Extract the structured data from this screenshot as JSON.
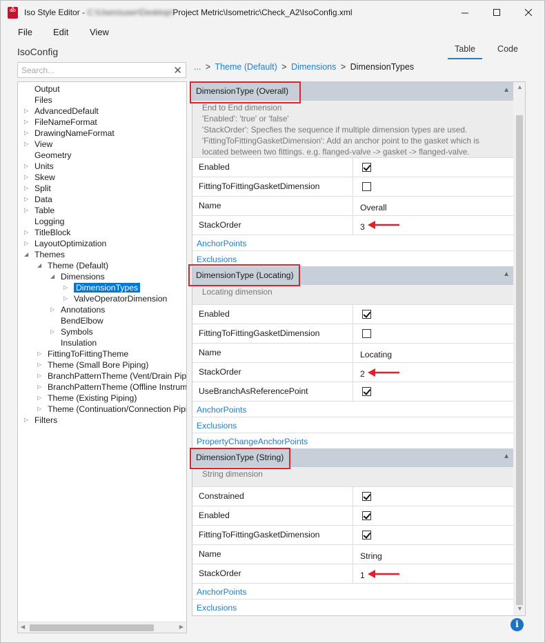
{
  "window": {
    "app_name": "Iso Style Editor",
    "title_separator": " - ",
    "title_blurred": "C:\\Users\\user\\Desktop\\",
    "title_path": "Project Metric\\Isometric\\Check_A2\\IsoConfig.xml",
    "icon_letter": "A",
    "icon_sub": "ISO"
  },
  "menu": {
    "file": "File",
    "edit": "Edit",
    "view": "View"
  },
  "header": {
    "title": "IsoConfig",
    "tab_table": "Table",
    "tab_code": "Code"
  },
  "search": {
    "placeholder": "Search...",
    "value": ""
  },
  "tree": [
    {
      "label": "Output",
      "level": 0,
      "arrow": false
    },
    {
      "label": "Files",
      "level": 0,
      "arrow": false
    },
    {
      "label": "AdvancedDefault",
      "level": 0,
      "arrow": true
    },
    {
      "label": "FileNameFormat",
      "level": 0,
      "arrow": true
    },
    {
      "label": "DrawingNameFormat",
      "level": 0,
      "arrow": true
    },
    {
      "label": "View",
      "level": 0,
      "arrow": true
    },
    {
      "label": "Geometry",
      "level": 0,
      "arrow": false
    },
    {
      "label": "Units",
      "level": 0,
      "arrow": true
    },
    {
      "label": "Skew",
      "level": 0,
      "arrow": true
    },
    {
      "label": "Split",
      "level": 0,
      "arrow": true
    },
    {
      "label": "Data",
      "level": 0,
      "arrow": true
    },
    {
      "label": "Table",
      "level": 0,
      "arrow": true
    },
    {
      "label": "Logging",
      "level": 0,
      "arrow": false
    },
    {
      "label": "TitleBlock",
      "level": 0,
      "arrow": true
    },
    {
      "label": "LayoutOptimization",
      "level": 0,
      "arrow": true
    },
    {
      "label": "Themes",
      "level": 0,
      "arrow": "open"
    },
    {
      "label": "Theme (Default)",
      "level": 1,
      "arrow": "open"
    },
    {
      "label": "Dimensions",
      "level": 2,
      "arrow": "open"
    },
    {
      "label": "DimensionTypes",
      "level": 3,
      "arrow": true,
      "selected": true
    },
    {
      "label": "ValveOperatorDimension",
      "level": 3,
      "arrow": true
    },
    {
      "label": "Annotations",
      "level": 2,
      "arrow": true
    },
    {
      "label": "BendElbow",
      "level": 2,
      "arrow": false
    },
    {
      "label": "Symbols",
      "level": 2,
      "arrow": true
    },
    {
      "label": "Insulation",
      "level": 2,
      "arrow": false
    },
    {
      "label": "FittingToFittingTheme",
      "level": 1,
      "arrow": true
    },
    {
      "label": "Theme (Small Bore Piping)",
      "level": 1,
      "arrow": true
    },
    {
      "label": "BranchPatternTheme (Vent/Drain Piping)",
      "level": 1,
      "arrow": true
    },
    {
      "label": "BranchPatternTheme (Offline Instruments)",
      "level": 1,
      "arrow": true
    },
    {
      "label": "Theme (Existing Piping)",
      "level": 1,
      "arrow": true
    },
    {
      "label": "Theme (Continuation/Connection Piping)",
      "level": 1,
      "arrow": true
    },
    {
      "label": "Filters",
      "level": 0,
      "arrow": true
    }
  ],
  "breadcrumb": {
    "ellipsis": "...",
    "sep": ">",
    "item1": "Theme (Default)",
    "item2": "Dimensions",
    "current": "DimensionTypes"
  },
  "sections": {
    "overall": {
      "title": "DimensionType (Overall)",
      "desc": [
        "End to End dimension",
        "'Enabled': 'true' or 'false'",
        "'StackOrder': Specfies the sequence if multiple dimension types are used.",
        "'FittingToFittingGasketDimension': Add an anchor point to the gasket which is",
        "located between two fittings. e.g. flanged-valve -> gasket -> flanged-valve."
      ],
      "enabled_label": "Enabled",
      "gasket_label": "FittingToFittingGasketDimension",
      "name_label": "Name",
      "name_value": "Overall",
      "stack_label": "StackOrder",
      "stack_value": "3",
      "anchor_link": "AnchorPoints",
      "exclusions_link": "Exclusions"
    },
    "locating": {
      "title": "DimensionType (Locating)",
      "desc": "Locating dimension",
      "enabled_label": "Enabled",
      "gasket_label": "FittingToFittingGasketDimension",
      "name_label": "Name",
      "name_value": "Locating",
      "stack_label": "StackOrder",
      "stack_value": "2",
      "branch_label": "UseBranchAsReferencePoint",
      "anchor_link": "AnchorPoints",
      "exclusions_link": "Exclusions",
      "prop_change_link": "PropertyChangeAnchorPoints"
    },
    "string": {
      "title": "DimensionType (String)",
      "desc": "String dimension",
      "constrained_label": "Constrained",
      "enabled_label": "Enabled",
      "gasket_label": "FittingToFittingGasketDimension",
      "name_label": "Name",
      "name_value": "String",
      "stack_label": "StackOrder",
      "stack_value": "1",
      "anchor_link": "AnchorPoints",
      "exclusions_link": "Exclusions"
    }
  },
  "checks": {
    "overall_enabled": true,
    "overall_gasket": false,
    "locating_enabled": true,
    "locating_gasket": false,
    "locating_branch": true,
    "string_constrained": true,
    "string_enabled": true,
    "string_gasket": true
  },
  "colors": {
    "accent": "#1f7ec9",
    "highlight": "#e0202a",
    "section_header": "#c7d0d9",
    "selected": "#0078d7"
  },
  "icons": {
    "info": "info-icon",
    "collapse": "triangle-up-icon"
  }
}
